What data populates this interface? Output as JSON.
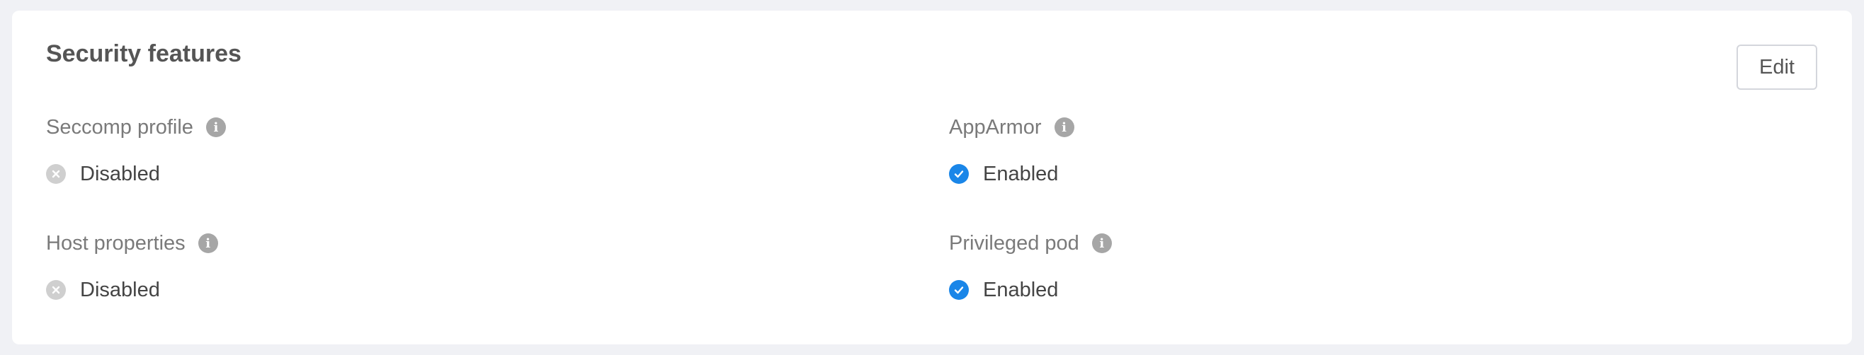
{
  "card": {
    "title": "Security features",
    "edit_label": "Edit"
  },
  "fields": {
    "seccomp": {
      "label": "Seccomp profile",
      "value": "Disabled",
      "state": "off"
    },
    "apparmor": {
      "label": "AppArmor",
      "value": "Enabled",
      "state": "on"
    },
    "host": {
      "label": "Host properties",
      "value": "Disabled",
      "state": "off"
    },
    "privileged": {
      "label": "Privileged pod",
      "value": "Enabled",
      "state": "on"
    }
  },
  "icons": {
    "info": "info-icon",
    "enabled": "check-circle-icon",
    "disabled": "x-circle-icon"
  },
  "colors": {
    "enabled_blue": "#1a86e8",
    "disabled_gray": "#cfcfcf",
    "info_gray": "#a6a6a6"
  }
}
